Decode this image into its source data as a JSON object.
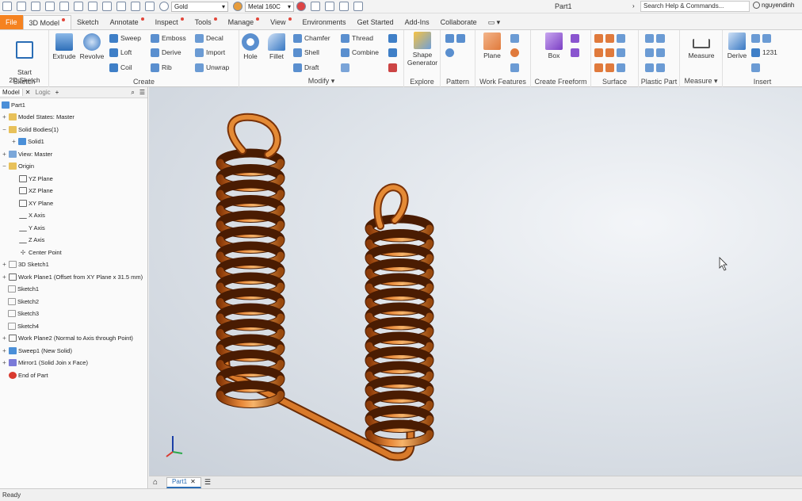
{
  "window": {
    "title": "Part1",
    "search_placeholder": "Search Help & Commands...",
    "user": "nguyendinh"
  },
  "qat": {
    "material": "Gold",
    "appearance": "Metal 160C"
  },
  "tabs": [
    "File",
    "3D Model",
    "Sketch",
    "Annotate",
    "Inspect",
    "Tools",
    "Manage",
    "View",
    "Environments",
    "Get Started",
    "Add-Ins",
    "Collaborate"
  ],
  "ribbon": {
    "sketch": {
      "label": "Sketch",
      "start": "Start\n2D Sketch"
    },
    "create": {
      "label": "Create",
      "extrude": "Extrude",
      "revolve": "Revolve",
      "sweep": "Sweep",
      "loft": "Loft",
      "coil": "Coil",
      "emboss": "Emboss",
      "derive": "Derive",
      "rib": "Rib",
      "decal": "Decal",
      "import": "Import",
      "unwrap": "Unwrap"
    },
    "modify": {
      "label": "Modify",
      "hole": "Hole",
      "fillet": "Fillet",
      "chamfer": "Chamfer",
      "shell": "Shell",
      "draft": "Draft",
      "thread": "Thread",
      "combine": "Combine"
    },
    "explore": {
      "label": "Explore",
      "shape_generator": "Shape\nGenerator"
    },
    "pattern": {
      "label": "Pattern"
    },
    "work_features": {
      "label": "Work Features",
      "plane": "Plane"
    },
    "freeform": {
      "label": "Create Freeform",
      "box": "Box"
    },
    "surface": {
      "label": "Surface"
    },
    "plastic": {
      "label": "Plastic Part"
    },
    "measure": {
      "label": "Measure",
      "measure": "Measure"
    },
    "insert": {
      "label": "Insert",
      "derive": "Derive",
      "value": "1231"
    }
  },
  "browser": {
    "tabs": [
      "Model",
      "Logic"
    ],
    "nodes": [
      {
        "label": "Part1"
      },
      {
        "label": "Model States: Master"
      },
      {
        "label": "Solid Bodies(1)"
      },
      {
        "label": "Solid1"
      },
      {
        "label": "View: Master"
      },
      {
        "label": "Origin"
      },
      {
        "label": "YZ Plane"
      },
      {
        "label": "XZ Plane"
      },
      {
        "label": "XY Plane"
      },
      {
        "label": "X Axis"
      },
      {
        "label": "Y Axis"
      },
      {
        "label": "Z Axis"
      },
      {
        "label": "Center Point"
      },
      {
        "label": "3D Sketch1"
      },
      {
        "label": "Work Plane1 (Offset from XY Plane x 31.5 mm)"
      },
      {
        "label": "Sketch1"
      },
      {
        "label": "Sketch2"
      },
      {
        "label": "Sketch3"
      },
      {
        "label": "Sketch4"
      },
      {
        "label": "Work Plane2 (Normal to Axis through Point)"
      },
      {
        "label": "Sweep1 (New Solid)"
      },
      {
        "label": "Mirror1 (Solid Join x Face)"
      },
      {
        "label": "End of Part"
      }
    ]
  },
  "doc_tab": "Part1",
  "status": "Ready",
  "colors": {
    "accent": "#f58220",
    "spring": "#c8620f",
    "spring_light": "#f0a050",
    "spring_dark": "#6b2c05"
  }
}
